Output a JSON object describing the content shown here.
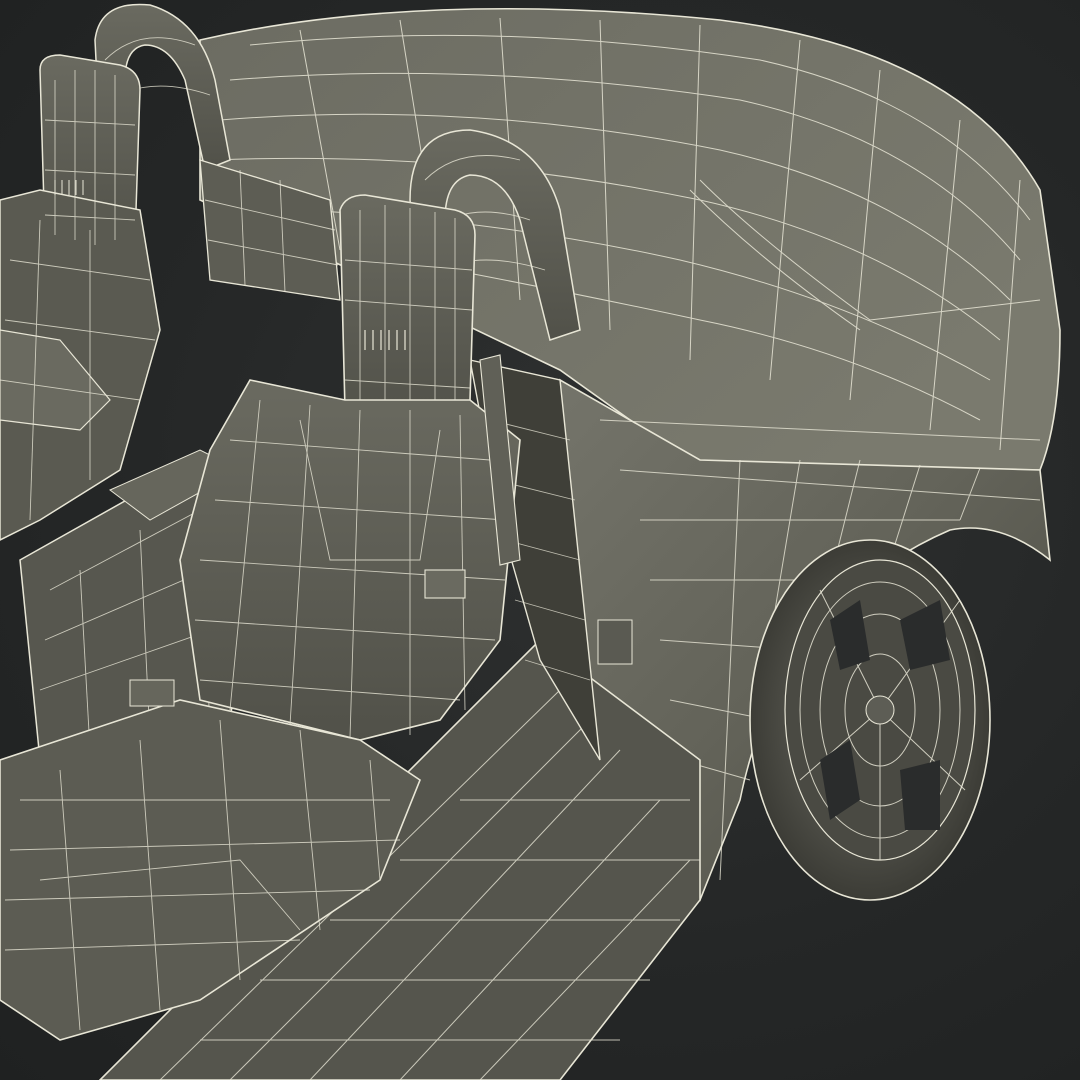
{
  "scene": {
    "subject": "wireframe-car-model",
    "view": "rear-quarter-interior",
    "colors": {
      "background": "#262828",
      "body": "#5f5f54",
      "body_light": "#76766a",
      "body_dark": "#45453d",
      "wire": "#e8e6d6"
    }
  }
}
